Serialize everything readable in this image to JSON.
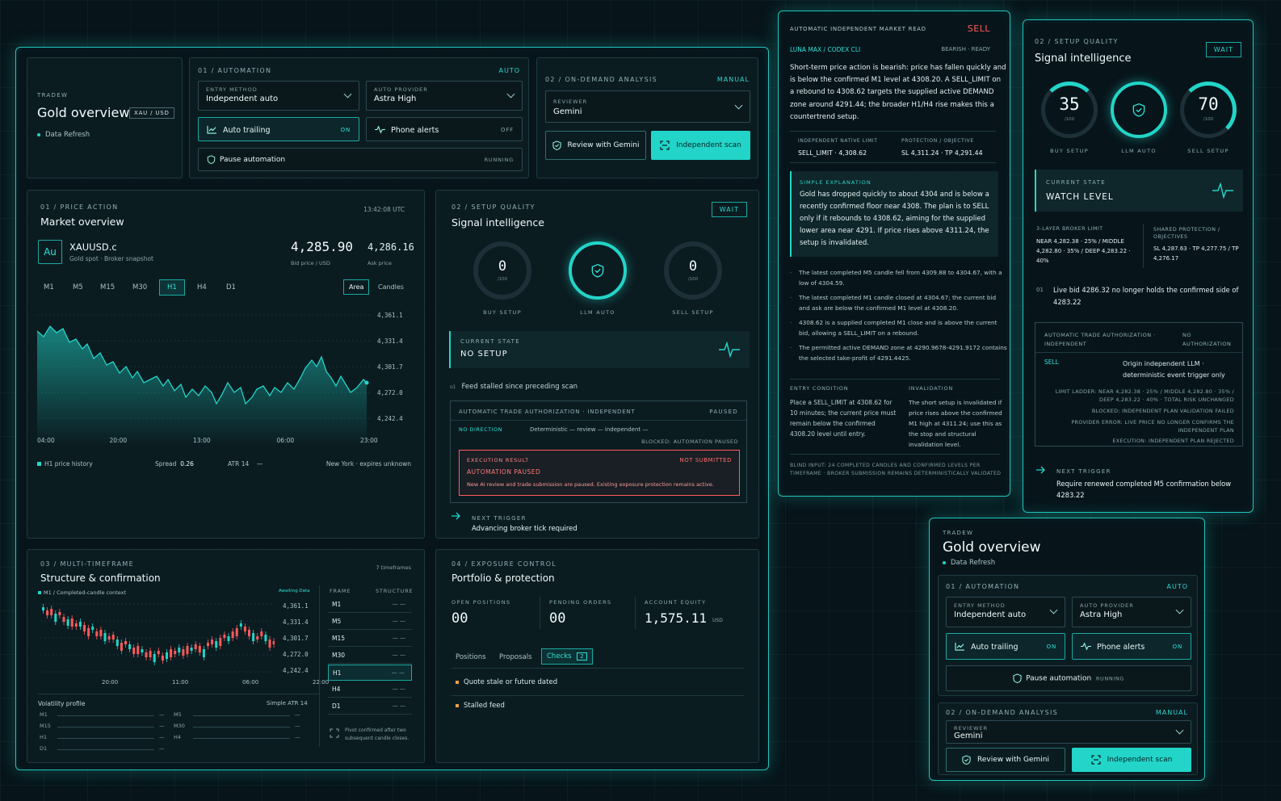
{
  "main": {
    "header": {
      "eyebrow": "TRADEW",
      "title": "Gold overview",
      "pair": "XAU / USD",
      "refresh": "Data Refresh"
    },
    "automation": {
      "section": "01 / AUTOMATION",
      "mode": "AUTO",
      "entry_label": "ENTRY METHOD",
      "entry_value": "Independent auto",
      "provider_label": "AUTO PROVIDER",
      "provider_value": "Astra High",
      "trailing_label": "Auto trailing",
      "trailing_state": "ON",
      "alerts_label": "Phone alerts",
      "alerts_state": "OFF",
      "pause_label": "Pause automation",
      "pause_state": "RUNNING"
    },
    "analysis": {
      "section": "02 / ON-DEMAND ANALYSIS",
      "mode": "MANUAL",
      "reviewer_label": "REVIEWER",
      "reviewer_value": "Gemini",
      "review_btn": "Review with Gemini",
      "scan_btn": "Independent scan"
    },
    "market": {
      "section": "01 / PRICE ACTION",
      "title": "Market overview",
      "time": "13:42:08 UTC",
      "symbol": "XAUUSD.c",
      "symbol_badge": "Au",
      "symbol_sub": "Gold spot · Broker snapshot",
      "bid": "4,285.90",
      "bid_label": "Bid price / USD",
      "ask": "4,286.16",
      "ask_label": "Ask price",
      "timeframes": [
        "M1",
        "M5",
        "M15",
        "M30",
        "H1",
        "H4",
        "D1"
      ],
      "active_tf": "H1",
      "view_area": "Area",
      "view_candles": "Candles",
      "yticks": [
        "4,361.1",
        "4,331.4",
        "4,301.7",
        "4,272.0",
        "4,242.4"
      ],
      "xticks": [
        "04:00",
        "20:00",
        "13:00",
        "06:00",
        "23:00"
      ],
      "legend": "H1 price history",
      "spread_label": "Spread",
      "spread": "0.26",
      "atr_label": "ATR 14",
      "atr": "—",
      "session": "New York · expires unknown"
    },
    "signal": {
      "section": "02 / SETUP QUALITY",
      "title": "Signal intelligence",
      "badge": "WAIT",
      "buy": "0",
      "buy_sub": "/100",
      "buy_label": "BUY SETUP",
      "llm_label": "LLM AUTO",
      "sell": "0",
      "sell_sub": "/100",
      "sell_label": "SELL SETUP",
      "state_label": "CURRENT STATE",
      "state": "NO SETUP",
      "feed_note": "Feed stalled since preceding scan",
      "auth_title": "AUTOMATIC TRADE AUTHORIZATION · Independent",
      "auth_state": "PAUSED",
      "direction": "NO DIRECTION",
      "flow": "Deterministic — review — independent —",
      "blocked": "BLOCKED: AUTOMATION PAUSED",
      "exec_label": "EXECUTION RESULT",
      "exec_state": "NOT SUBMITTED",
      "exec_title": "AUTOMATION PAUSED",
      "exec_text": "New AI review and trade submission are paused. Existing exposure protection remains active.",
      "trigger_label": "NEXT TRIGGER",
      "trigger": "Advancing broker tick required"
    },
    "mtf": {
      "section": "03 / MULTI-TIMEFRAME",
      "count": "7 timeframes",
      "title": "Structure & confirmation",
      "legend": "M1 / Completed-candle context",
      "awaiting": "Awaiting Data",
      "yticks": [
        "4,361.1",
        "4,331.4",
        "4,301.7",
        "4,272.0",
        "4,242.4"
      ],
      "xticks": [
        "20:00",
        "11:00",
        "06:00",
        "22:00"
      ],
      "vol_title": "Volatility profile",
      "vol_sub": "Simple ATR 14",
      "vol_left": [
        "M1",
        "M15",
        "H1",
        "D1"
      ],
      "vol_right": [
        "M5",
        "M30",
        "H4"
      ],
      "frame_head": "FRAME",
      "structure_head": "STRUCTURE",
      "frames": [
        "M1",
        "M5",
        "M15",
        "M30",
        "H1",
        "H4",
        "D1"
      ],
      "frame_value": "— —",
      "pivot_note": "Pivot confirmed after two subsequent candle closes."
    },
    "portfolio": {
      "section": "04 / EXPOSURE CONTROL",
      "title": "Portfolio & protection",
      "open_label": "OPEN POSITIONS",
      "open": "00",
      "pending_label": "PENDING ORDERS",
      "pending": "00",
      "equity_label": "ACCOUNT EQUITY",
      "equity": "1,575.11",
      "currency": "USD",
      "tabs": [
        "Positions",
        "Proposals",
        "Checks"
      ],
      "checks_count": "2",
      "checks": [
        "Quote stale or future dated",
        "Stalled feed"
      ]
    }
  },
  "read": {
    "title": "AUTOMATIC INDEPENDENT MARKET READ",
    "verdict": "SELL",
    "source": "LUNA MAX / CODEX CLI",
    "bias": "BEARISH · READY",
    "summary": "Short-term price action is bearish: price has fallen quickly and is below the confirmed M1 level at 4308.20. A SELL_LIMIT on a rebound to 4308.62 targets the supplied active DEMAND zone around 4291.44; the broader H1/H4 rise makes this a countertrend setup.",
    "limit_label": "INDEPENDENT NATIVE LIMIT",
    "limit": "SELL_LIMIT · 4,308.62",
    "prot_label": "PROTECTION / OBJECTIVE",
    "prot": "SL 4,311.24 · TP 4,291.44",
    "simple_label": "SIMPLE EXPLANATION",
    "simple": "Gold has dropped quickly to about 4304 and is below a recently confirmed floor near 4308. The plan is to SELL only if it rebounds to 4308.62, aiming for the supplied lower area near 4291. If price rises above 4311.24, the setup is invalidated.",
    "points": [
      "The latest completed M5 candle fell from 4309.88 to 4304.67, with a low of 4304.59.",
      "The latest completed M1 candle closed at 4304.67; the current bid and ask are below the confirmed M1 level at 4308.20.",
      "4308.62 is a supplied completed M1 close and is above the current bid, allowing a SELL_LIMIT on a rebound.",
      "The permitted active DEMAND zone at 4290.9678-4291.9172 contains the selected take-profit of 4291.4425."
    ],
    "entry_label": "ENTRY CONDITION",
    "entry": "Place a SELL_LIMIT at 4308.62 for 10 minutes; the current price must remain below the confirmed 4308.20 level until entry.",
    "inval_label": "INVALIDATION",
    "inval": "The short setup is invalidated if price rises above the confirmed M1 high at 4311.24; use this as the stop and structural invalidation level.",
    "footer": "BLIND INPUT: 24 COMPLETED CANDLES AND CONFIRMED LEVELS PER TIMEFRAME · BROKER SUBMISSION REMAINS DETERMINISTICALLY VALIDATED"
  },
  "sig2": {
    "section": "02 / SETUP QUALITY",
    "title": "Signal intelligence",
    "badge": "WAIT",
    "buy": "35",
    "buy_sub": "/100",
    "buy_label": "BUY SETUP",
    "llm_label": "LLM AUTO",
    "sell": "70",
    "sell_sub": "/100",
    "sell_label": "SELL SETUP",
    "state_label": "CURRENT STATE",
    "state": "WATCH LEVEL",
    "limit_label": "3-LAYER BROKER LIMIT",
    "limit": "NEAR 4,282.38 · 25% / MIDDLE 4,282.80 · 35% / DEEP 4,283.22 · 40%",
    "shared_label": "SHARED PROTECTION / OBJECTIVES",
    "shared": "SL 4,287.63 · TP 4,277.75 / TP 4,276.17",
    "note_num": "01",
    "note": "Live bid 4286.32 no longer holds the confirmed side of 4283.22",
    "auth_title": "AUTOMATIC TRADE AUTHORIZATION · independent",
    "auth_state": "NO AUTHORIZATION",
    "side": "SELL",
    "origin": "Origin independent LLM · deterministic event trigger only",
    "ladder": "LIMIT LADDER: NEAR 4,282.38 · 25% / MIDDLE 4,282.80 · 35% / DEEP 4,283.22 · 40% · TOTAL RISK UNCHANGED",
    "blocked": "BLOCKED: INDEPENDENT PLAN VALIDATION FAILED",
    "provider_err": "PROVIDER ERROR: LIVE PRICE NO LONGER CONFIRMS THE INDEPENDENT PLAN",
    "execution": "EXECUTION: INDEPENDENT PLAN REJECTED",
    "trigger_label": "NEXT TRIGGER",
    "trigger": "Require renewed completed M5 confirmation below 4283.22"
  },
  "mini": {
    "eyebrow": "TRADEW",
    "title": "Gold overview",
    "refresh": "Data Refresh",
    "section": "01 / AUTOMATION",
    "mode": "AUTO",
    "entry_label": "ENTRY METHOD",
    "entry_value": "Independent auto",
    "provider_label": "AUTO PROVIDER",
    "provider_value": "Astra High",
    "trailing_label": "Auto trailing",
    "trailing_state": "ON",
    "alerts_label": "Phone alerts",
    "alerts_state": "ON",
    "pause_label": "Pause automation",
    "pause_state": "RUNNING",
    "analysis_section": "02 / ON-DEMAND ANALYSIS",
    "analysis_mode": "MANUAL",
    "reviewer_label": "REVIEWER",
    "reviewer_value": "Gemini",
    "review_btn": "Review with Gemini",
    "scan_btn": "Independent scan"
  },
  "colors": {
    "accent": "#22d5c8",
    "sell": "#ff5a5a",
    "bull_candle": "#22d5c8",
    "bear_candle": "#ff5a5a",
    "bg": "#071419"
  }
}
